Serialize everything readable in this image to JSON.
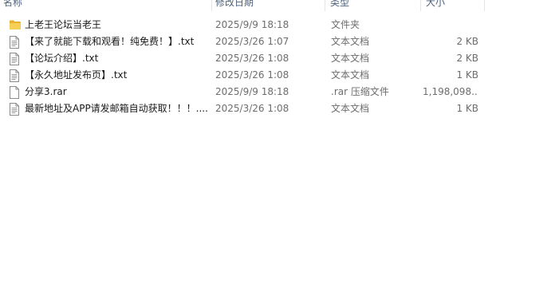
{
  "columns": {
    "name": "名称",
    "date": "修改日期",
    "type": "类型",
    "size": "大小"
  },
  "files": [
    {
      "icon": "folder-icon",
      "name": "上老王论坛当老王",
      "date": "2025/9/9 18:18",
      "type": "文件夹",
      "size": ""
    },
    {
      "icon": "text-file-icon",
      "name": "【来了就能下载和观看！纯免费！】.txt",
      "date": "2025/3/26 1:07",
      "type": "文本文档",
      "size": "2 KB"
    },
    {
      "icon": "text-file-icon",
      "name": "【论坛介绍】.txt",
      "date": "2025/3/26 1:08",
      "type": "文本文档",
      "size": "2 KB"
    },
    {
      "icon": "text-file-icon",
      "name": "【永久地址发布页】.txt",
      "date": "2025/3/26 1:08",
      "type": "文本文档",
      "size": "1 KB"
    },
    {
      "icon": "file-icon",
      "name": "分享3.rar",
      "date": "2025/9/9 18:18",
      "type": ".rar 压缩文件",
      "size": "1,198,098..."
    },
    {
      "icon": "text-file-icon",
      "name": "最新地址及APP请发邮箱自动获取！！！....",
      "date": "2025/3/26 1:08",
      "type": "文本文档",
      "size": "1 KB"
    }
  ]
}
